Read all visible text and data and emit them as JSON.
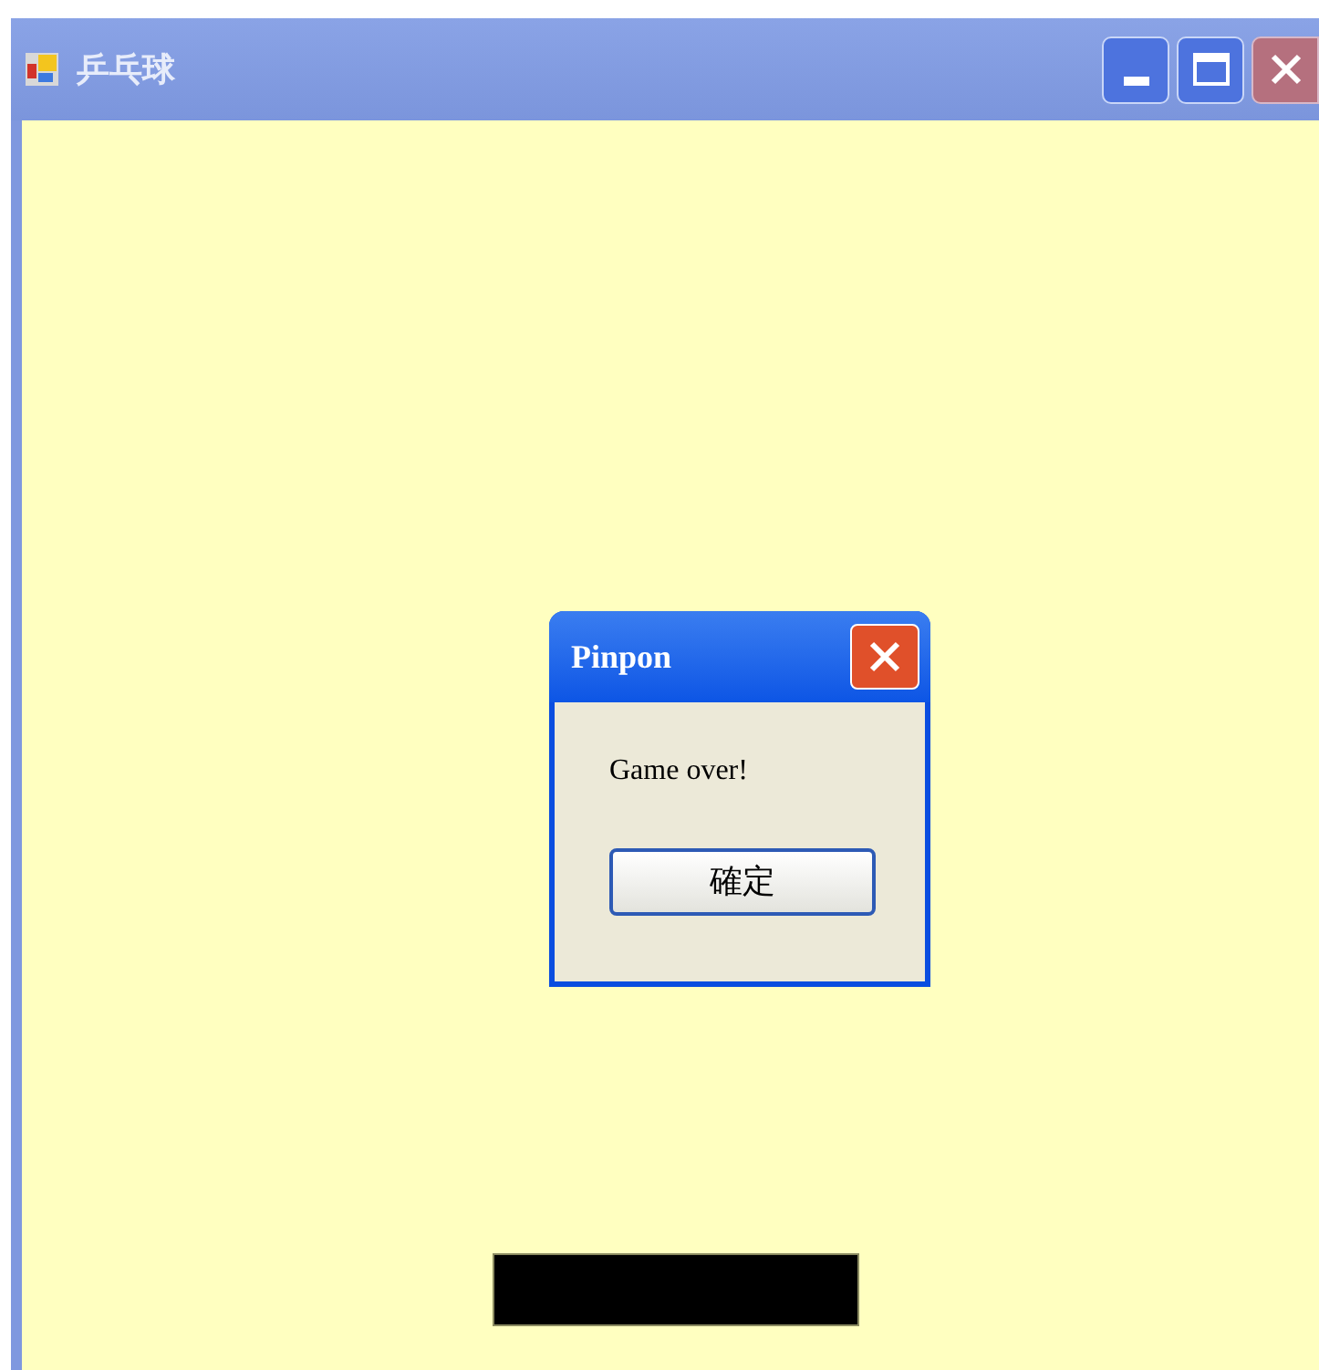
{
  "window": {
    "title": "乒乓球"
  },
  "dialog": {
    "title": "Pinpon",
    "message": "Game over!",
    "button": "確定"
  }
}
